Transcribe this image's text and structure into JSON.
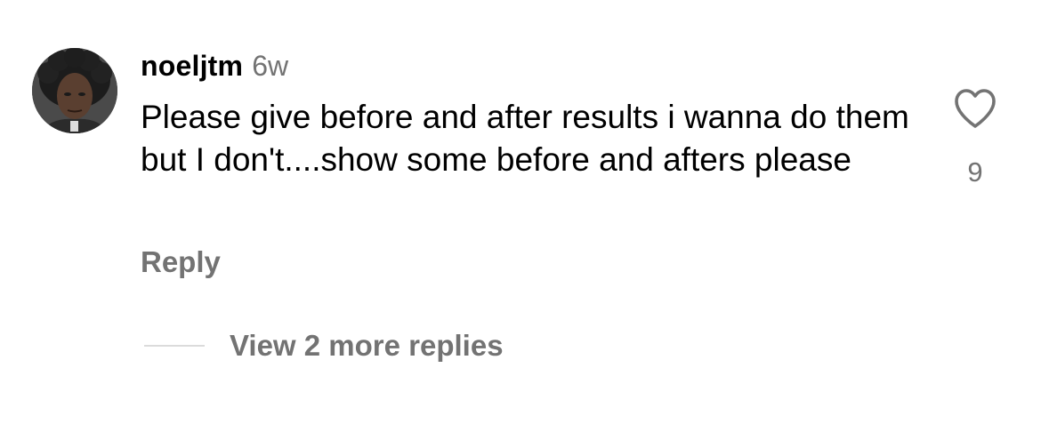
{
  "comment": {
    "avatar": "user-avatar",
    "username": "noeljtm",
    "timestamp": "6w",
    "text": "Please give before and after results i wanna do them but I don't....show some before and afters please",
    "reply_label": "Reply",
    "like_icon": "heart-outline-icon",
    "like_count": "9",
    "view_replies_label": "View 2 more replies"
  },
  "colors": {
    "primary_text": "#000000",
    "secondary_text": "#737373",
    "divider": "#dbdbdb",
    "background": "#ffffff"
  }
}
